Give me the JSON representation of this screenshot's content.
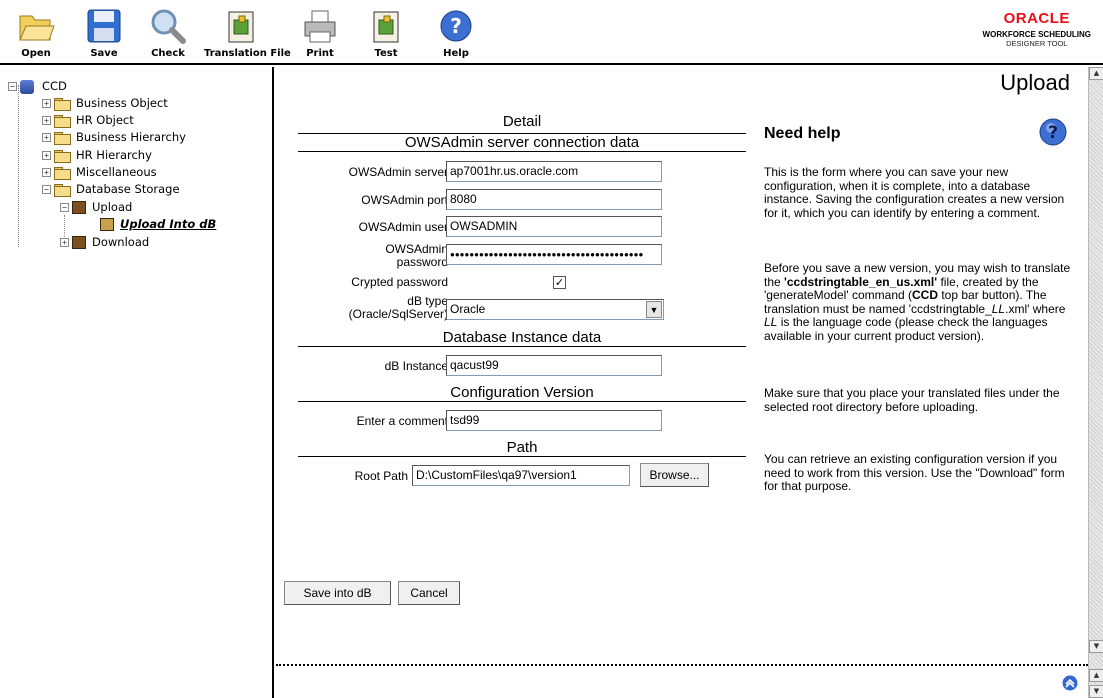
{
  "toolbar": {
    "buttons": [
      {
        "label": "Open",
        "icon": "folder-open-icon"
      },
      {
        "label": "Save",
        "icon": "floppy-disk-icon"
      },
      {
        "label": "Check",
        "icon": "magnifier-icon"
      },
      {
        "label": "Translation File",
        "icon": "puzzle-piece-icon"
      },
      {
        "label": "Print",
        "icon": "printer-icon"
      },
      {
        "label": "Test",
        "icon": "puzzle-test-icon"
      },
      {
        "label": "Help",
        "icon": "help-icon"
      }
    ],
    "logo": {
      "brand": "ORACLE",
      "line1": "WORKFORCE SCHEDULING",
      "line2": "DESIGNER TOOL",
      "color": "#e8101a"
    }
  },
  "tree": {
    "root": "CCD",
    "items": [
      {
        "label": "Business Object"
      },
      {
        "label": "HR Object"
      },
      {
        "label": "Business Hierarchy"
      },
      {
        "label": "HR Hierarchy"
      },
      {
        "label": "Miscellaneous"
      },
      {
        "label": "Database Storage"
      },
      {
        "label": "Upload"
      },
      {
        "label": "Upload Into dB"
      },
      {
        "label": "Download"
      }
    ]
  },
  "main": {
    "title": "Upload",
    "detail_title": "Detail",
    "sections": {
      "ows": "OWSAdmin server connection data",
      "db": "Database Instance data",
      "config": "Configuration Version",
      "path": "Path"
    },
    "fields": {
      "server_label": "OWSAdmin server",
      "server_value": "ap7001hr.us.oracle.com",
      "port_label": "OWSAdmin port",
      "port_value": "8080",
      "user_label": "OWSAdmin user",
      "user_value": "OWSADMIN",
      "password_label_1": "OWSAdmin",
      "password_label_2": "password",
      "password_value": "●●●●●●●●●●●●●●●●●●●●●●●●●●●●●●●●●●●●●●●●",
      "crypted_label": "Crypted password",
      "crypted_checked": true,
      "dbtype_label_1": "dB type",
      "dbtype_label_2": "(Oracle/SqlServer)",
      "dbtype_value": "Oracle",
      "instance_label": "dB Instance",
      "instance_value": "qacust99",
      "comment_label": "Enter a comment",
      "comment_value": "tsd99",
      "rootpath_label": "Root Path",
      "rootpath_value": "D:\\CustomFiles\\qa97\\version1",
      "browse_label": "Browse..."
    },
    "actions": {
      "save": "Save into dB",
      "cancel": "Cancel"
    },
    "help": {
      "title": "Need help",
      "p1": "This is the form where you can save your new configuration, when it is complete, into a database instance. Saving the configuration creates a new version for it, which you can identify by entering a comment.",
      "p2_a": "Before you save a new version, you may wish to translate the ",
      "p2_b": "'ccdstringtable_en_us.xml'",
      "p2_c": " file, created by the 'generateModel' command (",
      "p2_d": "CCD",
      "p2_e": " top bar button). The translation must be named 'ccdstringtable_",
      "p2_f": "LL",
      "p2_g": ".xml' where ",
      "p2_h": "LL",
      "p2_i": " is the language code (please check the languages available in your current product version).",
      "p3": "Make sure that you place your translated files under the selected root directory before uploading.",
      "p4": "You can retrieve an existing configuration version if you need to work from this version. Use the \"Download\" form for that purpose."
    }
  }
}
